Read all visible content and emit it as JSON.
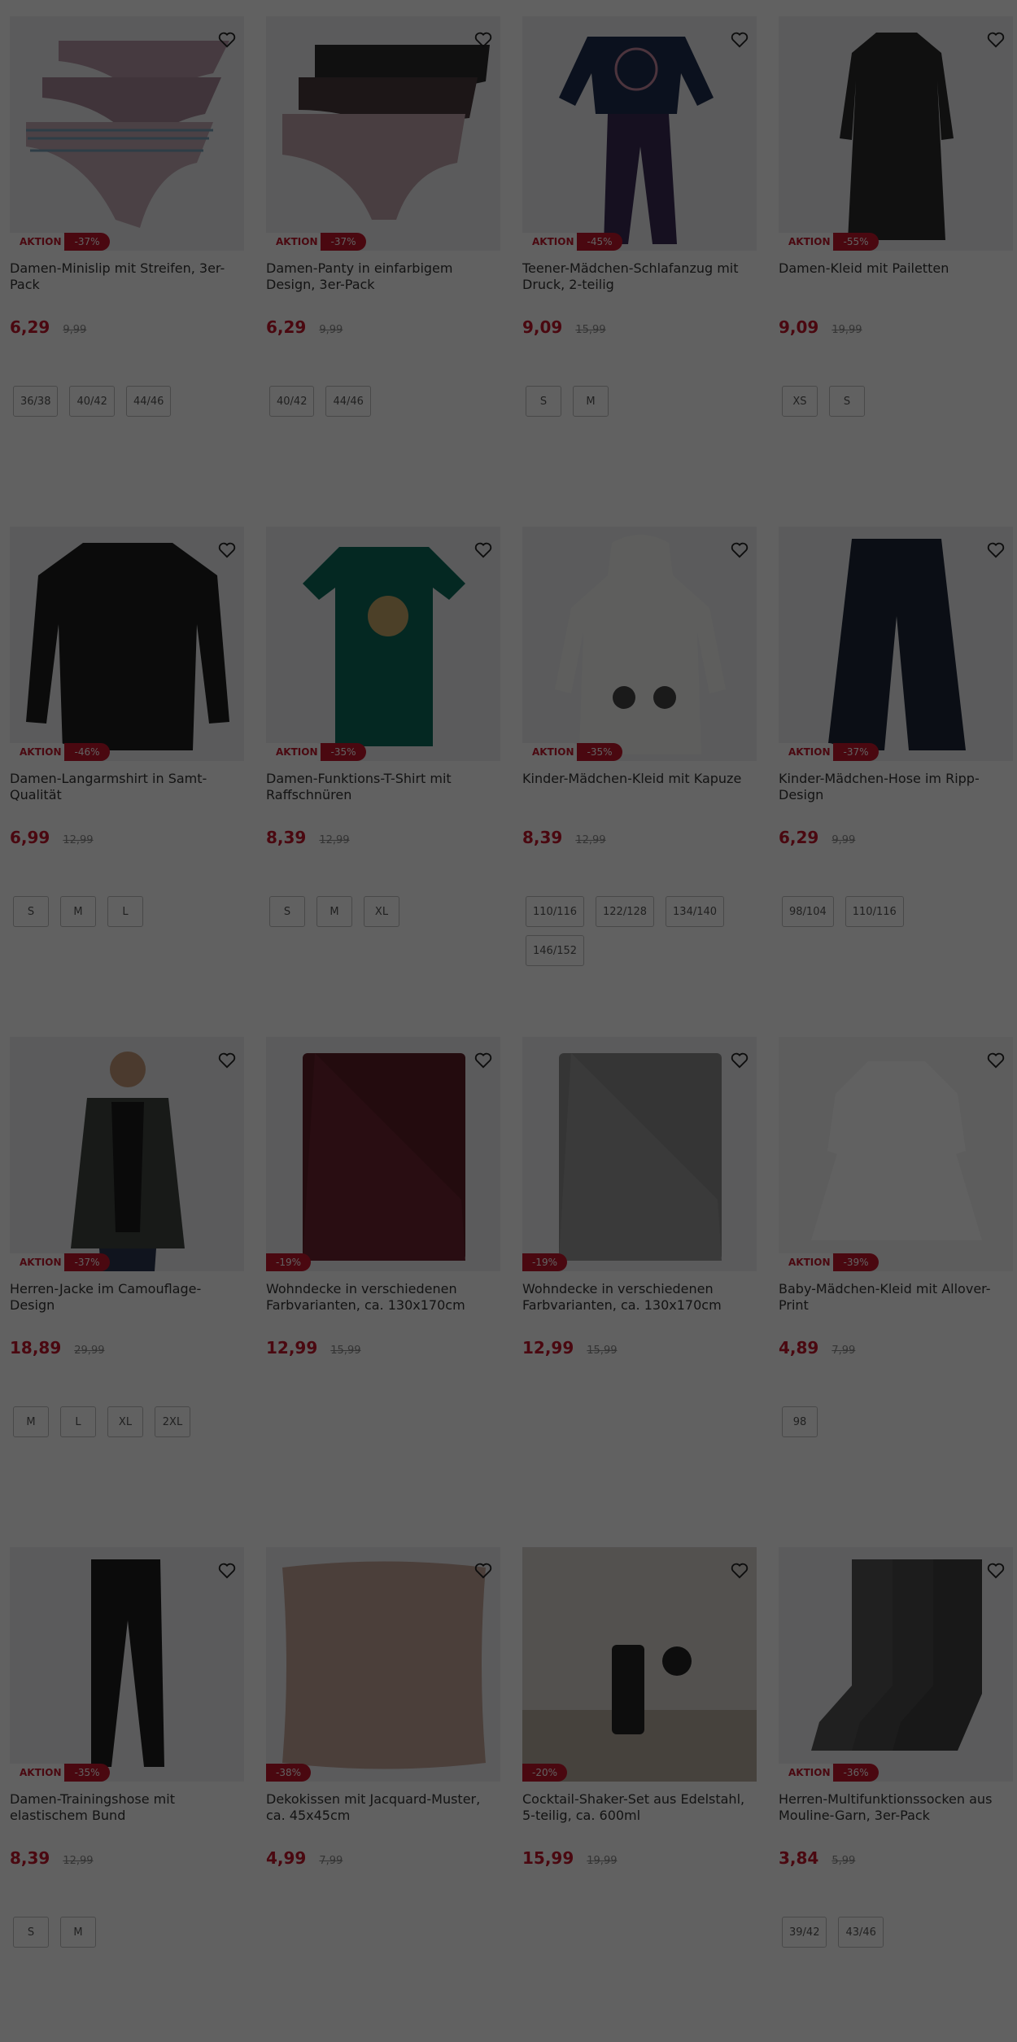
{
  "products": [
    {
      "title": "Damen-Minislip mit Streifen, 3er-Pack",
      "aktion": "AKTION",
      "discount": "-37%",
      "price": "6,29",
      "old_price": "9,99",
      "sizes": [
        "36/38",
        "40/42",
        "44/46"
      ],
      "art": "panties-stripe"
    },
    {
      "title": "Damen-Panty in einfarbigem Design, 3er-Pack",
      "aktion": "AKTION",
      "discount": "-37%",
      "price": "6,29",
      "old_price": "9,99",
      "sizes": [
        "40/42",
        "44/46"
      ],
      "art": "panties-solid"
    },
    {
      "title": "Teener-Mädchen-Schlafanzug mit Druck, 2-teilig",
      "aktion": "AKTION",
      "discount": "-45%",
      "price": "9,09",
      "old_price": "15,99",
      "sizes": [
        "S",
        "M"
      ],
      "art": "pyjama"
    },
    {
      "title": "Damen-Kleid mit Pailetten",
      "aktion": "AKTION",
      "discount": "-55%",
      "price": "9,09",
      "old_price": "19,99",
      "sizes": [
        "XS",
        "S"
      ],
      "art": "dress-dark"
    },
    {
      "title": "Damen-Langarmshirt in Samt-Qualität",
      "aktion": "AKTION",
      "discount": "-46%",
      "price": "6,99",
      "old_price": "12,99",
      "sizes": [
        "S",
        "M",
        "L"
      ],
      "art": "longsleeve"
    },
    {
      "title": "Damen-Funktions-T-Shirt mit Raffschnüren",
      "aktion": "AKTION",
      "discount": "-35%",
      "price": "8,39",
      "old_price": "12,99",
      "sizes": [
        "S",
        "M",
        "XL"
      ],
      "art": "tshirt"
    },
    {
      "title": "Kinder-Mädchen-Kleid mit Kapuze",
      "aktion": "AKTION",
      "discount": "-35%",
      "price": "8,39",
      "old_price": "12,99",
      "sizes": [
        "110/116",
        "122/128",
        "134/140",
        "146/152"
      ],
      "art": "hoodie-dress"
    },
    {
      "title": "Kinder-Mädchen-Hose im Ripp-Design",
      "aktion": "AKTION",
      "discount": "-37%",
      "price": "6,29",
      "old_price": "9,99",
      "sizes": [
        "98/104",
        "110/116"
      ],
      "art": "pants-wide"
    },
    {
      "title": "Herren-Jacke im Camouflage-Design",
      "aktion": "AKTION",
      "discount": "-37%",
      "price": "18,89",
      "old_price": "29,99",
      "sizes": [
        "M",
        "L",
        "XL",
        "2XL"
      ],
      "art": "jacket"
    },
    {
      "title": "Wohndecke in verschiedenen Farbvarianten, ca. 130x170cm",
      "aktion": "",
      "discount": "-19%",
      "price": "12,99",
      "old_price": "15,99",
      "sizes": [],
      "art": "blanket-red"
    },
    {
      "title": "Wohndecke in verschiedenen Farbvarianten, ca. 130x170cm",
      "aktion": "",
      "discount": "-19%",
      "price": "12,99",
      "old_price": "15,99",
      "sizes": [],
      "art": "blanket-grey"
    },
    {
      "title": "Baby-Mädchen-Kleid mit Allover-Print",
      "aktion": "AKTION",
      "discount": "-39%",
      "price": "4,89",
      "old_price": "7,99",
      "sizes": [
        "98"
      ],
      "art": "baby-dress"
    },
    {
      "title": "Damen-Trainingshose mit elastischem Bund",
      "aktion": "AKTION",
      "discount": "-35%",
      "price": "8,39",
      "old_price": "12,99",
      "sizes": [
        "S",
        "M"
      ],
      "art": "leggings"
    },
    {
      "title": "Dekokissen mit Jacquard-Muster, ca. 45x45cm",
      "aktion": "",
      "discount": "-38%",
      "price": "4,99",
      "old_price": "7,99",
      "sizes": [],
      "art": "pillow"
    },
    {
      "title": "Cocktail-Shaker-Set aus Edelstahl, 5-teilig, ca. 600ml",
      "aktion": "",
      "discount": "-20%",
      "price": "15,99",
      "old_price": "19,99",
      "sizes": [],
      "art": "shaker"
    },
    {
      "title": "Herren-Multifunktionssocken aus Mouline-Garn, 3er-Pack",
      "aktion": "AKTION",
      "discount": "-36%",
      "price": "3,84",
      "old_price": "5,99",
      "sizes": [
        "39/42",
        "43/46"
      ],
      "art": "socks"
    }
  ]
}
